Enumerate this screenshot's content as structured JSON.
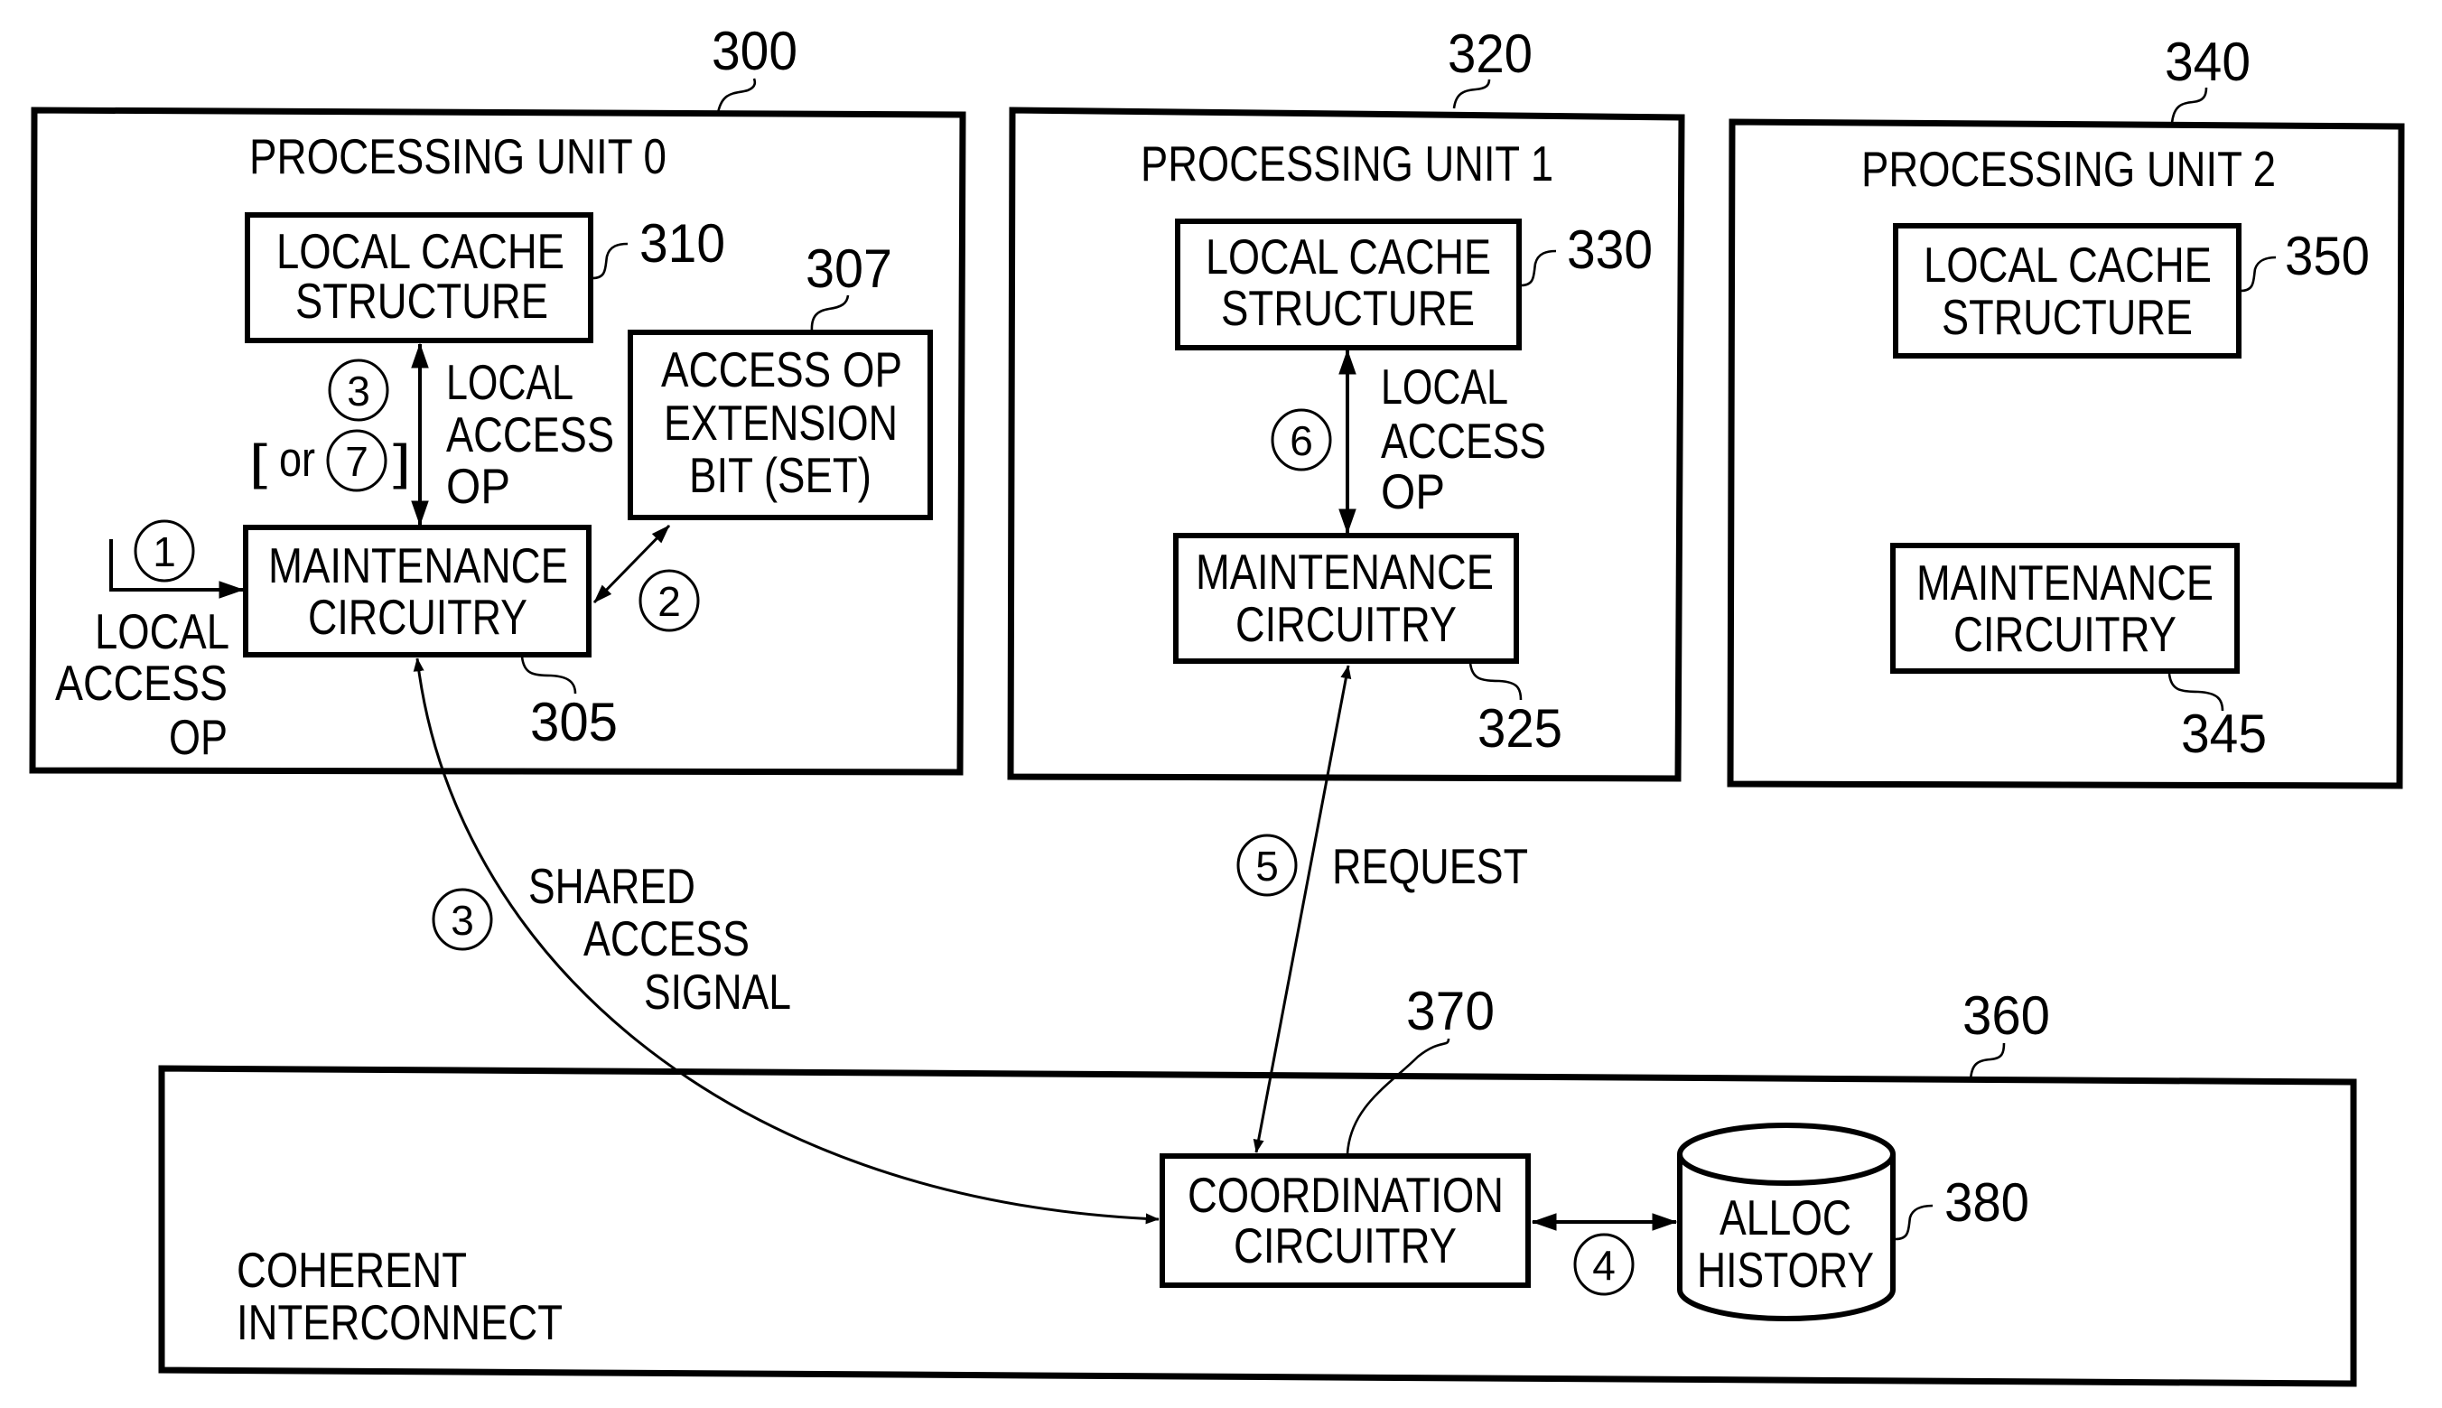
{
  "figure": {
    "units": [
      {
        "ref": "300",
        "title": "PROCESSING UNIT 0",
        "cache": {
          "ref": "310",
          "lines": [
            "LOCAL CACHE",
            "STRUCTURE"
          ]
        },
        "maintenance": {
          "ref": "305",
          "lines": [
            "MAINTENANCE",
            "CIRCUITRY"
          ]
        },
        "extension": {
          "ref": "307",
          "lines": [
            "ACCESS OP",
            "EXTENSION",
            "BIT (SET)"
          ]
        },
        "local_link": {
          "step": "3",
          "alt_prefix": "[",
          "alt_word": "or",
          "alt_step": "7",
          "alt_suffix": "]",
          "lines": [
            "LOCAL",
            "ACCESS",
            "OP"
          ]
        },
        "input": {
          "step": "1",
          "lines": [
            "LOCAL",
            "ACCESS",
            "OP"
          ]
        },
        "extension_link": {
          "step": "2"
        }
      },
      {
        "ref": "320",
        "title": "PROCESSING UNIT 1",
        "cache": {
          "ref": "330",
          "lines": [
            "LOCAL CACHE",
            "STRUCTURE"
          ]
        },
        "maintenance": {
          "ref": "325",
          "lines": [
            "MAINTENANCE",
            "CIRCUITRY"
          ]
        },
        "local_link": {
          "step": "6",
          "lines": [
            "LOCAL",
            "ACCESS",
            "OP"
          ]
        }
      },
      {
        "ref": "340",
        "title": "PROCESSING UNIT 2",
        "cache": {
          "ref": "350",
          "lines": [
            "LOCAL CACHE",
            "STRUCTURE"
          ]
        },
        "maintenance": {
          "ref": "345",
          "lines": [
            "MAINTENANCE",
            "CIRCUITRY"
          ]
        }
      }
    ],
    "interconnect": {
      "ref": "360",
      "lines": [
        "COHERENT",
        "INTERCONNECT"
      ],
      "coordination": {
        "ref": "370",
        "lines": [
          "COORDINATION",
          "CIRCUITRY"
        ]
      },
      "history": {
        "ref": "380",
        "lines": [
          "ALLOC",
          "HISTORY"
        ]
      },
      "history_link": {
        "step": "4"
      }
    },
    "shared_signal": {
      "step": "3",
      "lines": [
        "SHARED",
        "ACCESS",
        "SIGNAL"
      ]
    },
    "request": {
      "step": "5",
      "label": "REQUEST"
    }
  }
}
